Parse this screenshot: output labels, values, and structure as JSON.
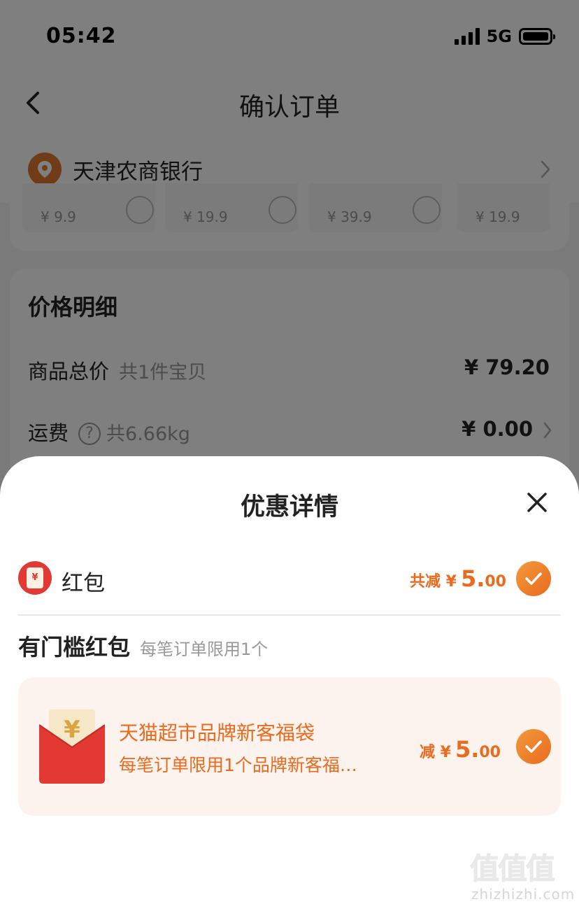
{
  "status_bar": {
    "time": "05:42",
    "network": "5G"
  },
  "header": {
    "title": "确认订单"
  },
  "bank": {
    "name": "天津农商银行"
  },
  "products": [
    {
      "price": "¥ 9.9"
    },
    {
      "price": "¥ 19.9"
    },
    {
      "price": "¥ 39.9"
    },
    {
      "price": "¥ 19.9"
    }
  ],
  "price_detail": {
    "title": "价格明细",
    "total_label": "商品总价",
    "total_sub": "共1件宝贝",
    "total_value": "¥ 79.20",
    "freight_label": "运费",
    "freight_sub": "共6.66kg",
    "freight_value": "¥ 0.00"
  },
  "sheet": {
    "title": "优惠详情",
    "red_packet": {
      "label": "红包",
      "total_prefix": "共减 ¥",
      "amount_int": "5.",
      "amount_dec": "00"
    },
    "threshold": {
      "label": "有门槛红包",
      "sub": "每笔订单限用1个"
    },
    "coupon": {
      "title": "天猫超市品牌新客福袋",
      "desc": "每笔订单限用1个品牌新客福…",
      "amount_prefix": "减 ¥",
      "amount_int": "5.",
      "amount_dec": "00"
    }
  },
  "watermark": {
    "logo": "值值值",
    "url": "zhizhizhi.com"
  },
  "colors": {
    "accent": "#ea6a1e",
    "red": "#e23a32",
    "coupon_bg": "#fdf3ee"
  }
}
